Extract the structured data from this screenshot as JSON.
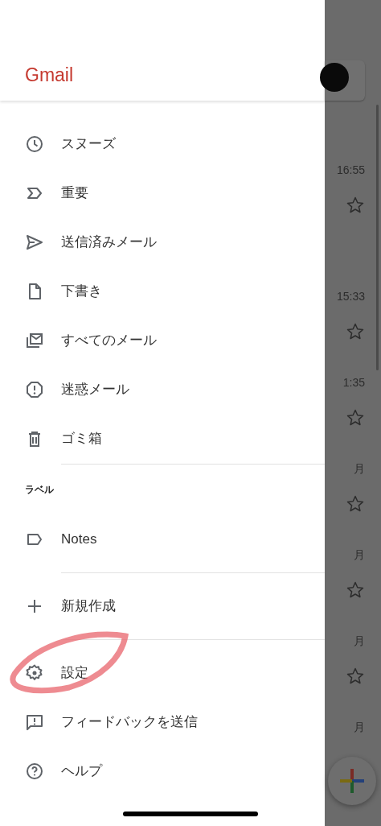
{
  "drawer": {
    "title": "Gmail",
    "items": [
      {
        "label": "スヌーズ"
      },
      {
        "label": "重要"
      },
      {
        "label": "送信済みメール"
      },
      {
        "label": "下書き"
      },
      {
        "label": "すべてのメール"
      },
      {
        "label": "迷惑メール"
      },
      {
        "label": "ゴミ箱"
      }
    ],
    "labels_heading": "ラベル",
    "labels": [
      {
        "label": "Notes"
      }
    ],
    "create": {
      "label": "新規作成"
    },
    "footer_items": [
      {
        "label": "設定"
      },
      {
        "label": "フィードバックを送信"
      },
      {
        "label": "ヘルプ"
      }
    ]
  },
  "inbox_behind": {
    "rows": [
      {
        "time": "16:55"
      },
      {
        "time": "15:33"
      },
      {
        "time": "1:35"
      },
      {
        "time": "月"
      },
      {
        "time": "月"
      },
      {
        "time": "月"
      },
      {
        "time": "月"
      }
    ]
  }
}
